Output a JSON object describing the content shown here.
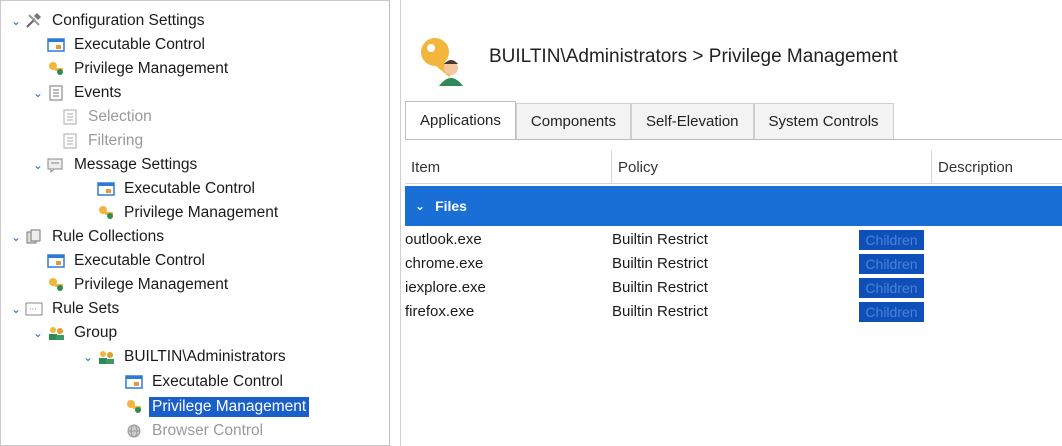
{
  "tree": {
    "items": [
      {
        "label": "Configuration Settings",
        "icon": "tools-icon",
        "level": 0,
        "expanded": true
      },
      {
        "label": "Executable Control",
        "icon": "window-icon",
        "level": 1
      },
      {
        "label": "Privilege Management",
        "icon": "key-user-icon",
        "level": 1
      },
      {
        "label": "Events",
        "icon": "document-icon",
        "level": 1,
        "expanded": true
      },
      {
        "label": "Selection",
        "icon": "document-icon",
        "level": 2,
        "disabled": true
      },
      {
        "label": "Filtering",
        "icon": "document-icon",
        "level": 2,
        "disabled": true
      },
      {
        "label": "Message Settings",
        "icon": "message-icon",
        "level": 1,
        "expanded": true
      },
      {
        "label": "Executable Control",
        "icon": "window-icon",
        "level": 2
      },
      {
        "label": "Privilege Management",
        "icon": "key-user-icon",
        "level": 2
      },
      {
        "label": "Rule Collections",
        "icon": "collection-icon",
        "level": 0,
        "expanded": true
      },
      {
        "label": "Executable Control",
        "icon": "window-icon",
        "level": 1
      },
      {
        "label": "Privilege Management",
        "icon": "key-user-icon",
        "level": 1
      },
      {
        "label": "Rule Sets",
        "icon": "ruleset-icon",
        "level": 0,
        "expanded": true
      },
      {
        "label": "Group",
        "icon": "group-icon",
        "level": 1,
        "expanded": true
      },
      {
        "label": "BUILTIN\\Administrators",
        "icon": "group-icon",
        "level": 2,
        "expanded": true
      },
      {
        "label": "Executable Control",
        "icon": "window-icon",
        "level": 3
      },
      {
        "label": "Privilege Management",
        "icon": "key-user-icon",
        "level": 3,
        "selected": true
      },
      {
        "label": "Browser Control",
        "icon": "globe-icon",
        "level": 3,
        "disabled": true
      }
    ]
  },
  "header": {
    "title": "BUILTIN\\Administrators > Privilege Management",
    "icon": "key-user-icon"
  },
  "tabs": [
    "Applications",
    "Components",
    "Self-Elevation",
    "System Controls"
  ],
  "active_tab": "Applications",
  "grid": {
    "columns": [
      "Item",
      "Policy",
      "Description"
    ],
    "group": "Files",
    "rows": [
      {
        "item": "outlook.exe",
        "policy": "Builtin Restrict",
        "badge": "Children"
      },
      {
        "item": "chrome.exe",
        "policy": "Builtin Restrict",
        "badge": "Children"
      },
      {
        "item": "iexplore.exe",
        "policy": "Builtin Restrict",
        "badge": "Children"
      },
      {
        "item": "firefox.exe",
        "policy": "Builtin Restrict",
        "badge": "Children"
      }
    ]
  },
  "colors": {
    "selection": "#1a5fc9",
    "group_header": "#1a6fd6",
    "badge": "#0e4fb8"
  }
}
